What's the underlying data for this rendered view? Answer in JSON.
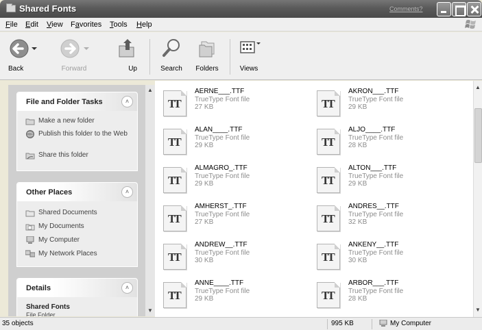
{
  "window": {
    "title": "Shared Fonts",
    "title_link": "Comments?"
  },
  "menu": [
    {
      "label": "File",
      "u": "F",
      "rest": "ile"
    },
    {
      "label": "Edit",
      "u": "E",
      "rest": "dit"
    },
    {
      "label": "View",
      "u": "V",
      "rest": "iew"
    },
    {
      "label": "Favorites",
      "u": "a",
      "pre": "F",
      "rest": "vorites"
    },
    {
      "label": "Tools",
      "u": "T",
      "rest": "ools"
    },
    {
      "label": "Help",
      "u": "H",
      "rest": "elp"
    }
  ],
  "toolbar": {
    "back": "Back",
    "forward": "Forward",
    "up": "Up",
    "search": "Search",
    "folders": "Folders",
    "views": "Views"
  },
  "taskpane": {
    "file_tasks": {
      "title": "File and Folder Tasks",
      "items": [
        "Make a new folder",
        "Publish this folder to the Web",
        "Share this folder"
      ]
    },
    "other_places": {
      "title": "Other Places",
      "items": [
        "Shared Documents",
        "My Documents",
        "My Computer",
        "My Network Places"
      ]
    },
    "details": {
      "title": "Details",
      "name": "Shared Fonts",
      "kind": "File Folder"
    }
  },
  "files": [
    {
      "name": "AERNE___.TTF",
      "type": "TrueType Font file",
      "size": "27 KB"
    },
    {
      "name": "AKRON___.TTF",
      "type": "TrueType Font file",
      "size": "29 KB"
    },
    {
      "name": "ALAN____.TTF",
      "type": "TrueType Font file",
      "size": "29 KB"
    },
    {
      "name": "ALJO____.TTF",
      "type": "TrueType Font file",
      "size": "28 KB"
    },
    {
      "name": "ALMAGRO_.TTF",
      "type": "TrueType Font file",
      "size": "29 KB"
    },
    {
      "name": "ALTON___.TTF",
      "type": "TrueType Font file",
      "size": "29 KB"
    },
    {
      "name": "AMHERST_.TTF",
      "type": "TrueType Font file",
      "size": "27 KB"
    },
    {
      "name": "ANDRES__.TTF",
      "type": "TrueType Font file",
      "size": "32 KB"
    },
    {
      "name": "ANDREW__.TTF",
      "type": "TrueType Font file",
      "size": "30 KB"
    },
    {
      "name": "ANKENY__.TTF",
      "type": "TrueType Font file",
      "size": "30 KB"
    },
    {
      "name": "ANNE____.TTF",
      "type": "TrueType Font file",
      "size": "29 KB"
    },
    {
      "name": "ARBOR___.TTF",
      "type": "TrueType Font file",
      "size": "28 KB"
    }
  ],
  "file_icon_glyph": "TT",
  "status": {
    "objects": "35 objects",
    "size": "995 KB",
    "location": "My Computer"
  }
}
